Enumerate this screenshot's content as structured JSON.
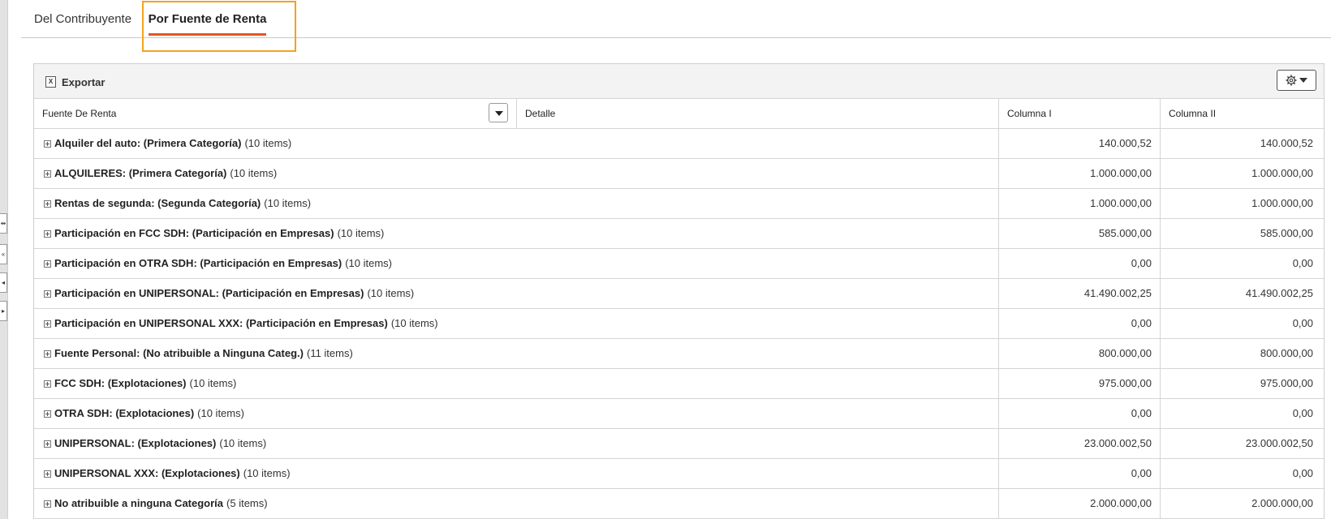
{
  "tabs": [
    {
      "label": "Del Contribuyente",
      "active": false
    },
    {
      "label": "Por Fuente de Renta",
      "active": true
    }
  ],
  "accent_color": "#e2571e",
  "highlight_color": "#f4a11d",
  "toolbar": {
    "export_label": "Exportar",
    "export_icon": "excel-icon",
    "settings_icon": "gear-icon"
  },
  "left_strip_icons": [
    "split-icon",
    "rewind-icon",
    "prev-icon",
    "next-icon"
  ],
  "columns": {
    "fuente": "Fuente De Renta",
    "detalle": "Detalle",
    "columna1": "Columna I",
    "columna2": "Columna II"
  },
  "rows": [
    {
      "title": "Alquiler del auto: (Primera Categoría)",
      "count": "(10 items)",
      "col1": "140.000,52",
      "col2": "140.000,52"
    },
    {
      "title": "ALQUILERES: (Primera Categoría)",
      "count": "(10 items)",
      "col1": "1.000.000,00",
      "col2": "1.000.000,00"
    },
    {
      "title": "Rentas de segunda: (Segunda Categoría)",
      "count": "(10 items)",
      "col1": "1.000.000,00",
      "col2": "1.000.000,00"
    },
    {
      "title": "Participación en FCC SDH: (Participación en Empresas)",
      "count": "(10 items)",
      "col1": "585.000,00",
      "col2": "585.000,00"
    },
    {
      "title": "Participación en OTRA SDH: (Participación en Empresas)",
      "count": "(10 items)",
      "col1": "0,00",
      "col2": "0,00"
    },
    {
      "title": "Participación en UNIPERSONAL: (Participación en Empresas)",
      "count": "(10 items)",
      "col1": "41.490.002,25",
      "col2": "41.490.002,25"
    },
    {
      "title": "Participación en UNIPERSONAL XXX: (Participación en Empresas)",
      "count": "(10 items)",
      "col1": "0,00",
      "col2": "0,00"
    },
    {
      "title": "Fuente Personal: (No atribuible a Ninguna Categ.)",
      "count": "(11 items)",
      "col1": "800.000,00",
      "col2": "800.000,00"
    },
    {
      "title": "FCC SDH: (Explotaciones)",
      "count": "(10 items)",
      "col1": "975.000,00",
      "col2": "975.000,00"
    },
    {
      "title": "OTRA SDH: (Explotaciones)",
      "count": "(10 items)",
      "col1": "0,00",
      "col2": "0,00"
    },
    {
      "title": "UNIPERSONAL: (Explotaciones)",
      "count": "(10 items)",
      "col1": "23.000.002,50",
      "col2": "23.000.002,50"
    },
    {
      "title": "UNIPERSONAL XXX: (Explotaciones)",
      "count": "(10 items)",
      "col1": "0,00",
      "col2": "0,00"
    },
    {
      "title": "No atribuible a ninguna Categoría",
      "count": "(5 items)",
      "col1": "2.000.000,00",
      "col2": "2.000.000,00"
    }
  ]
}
